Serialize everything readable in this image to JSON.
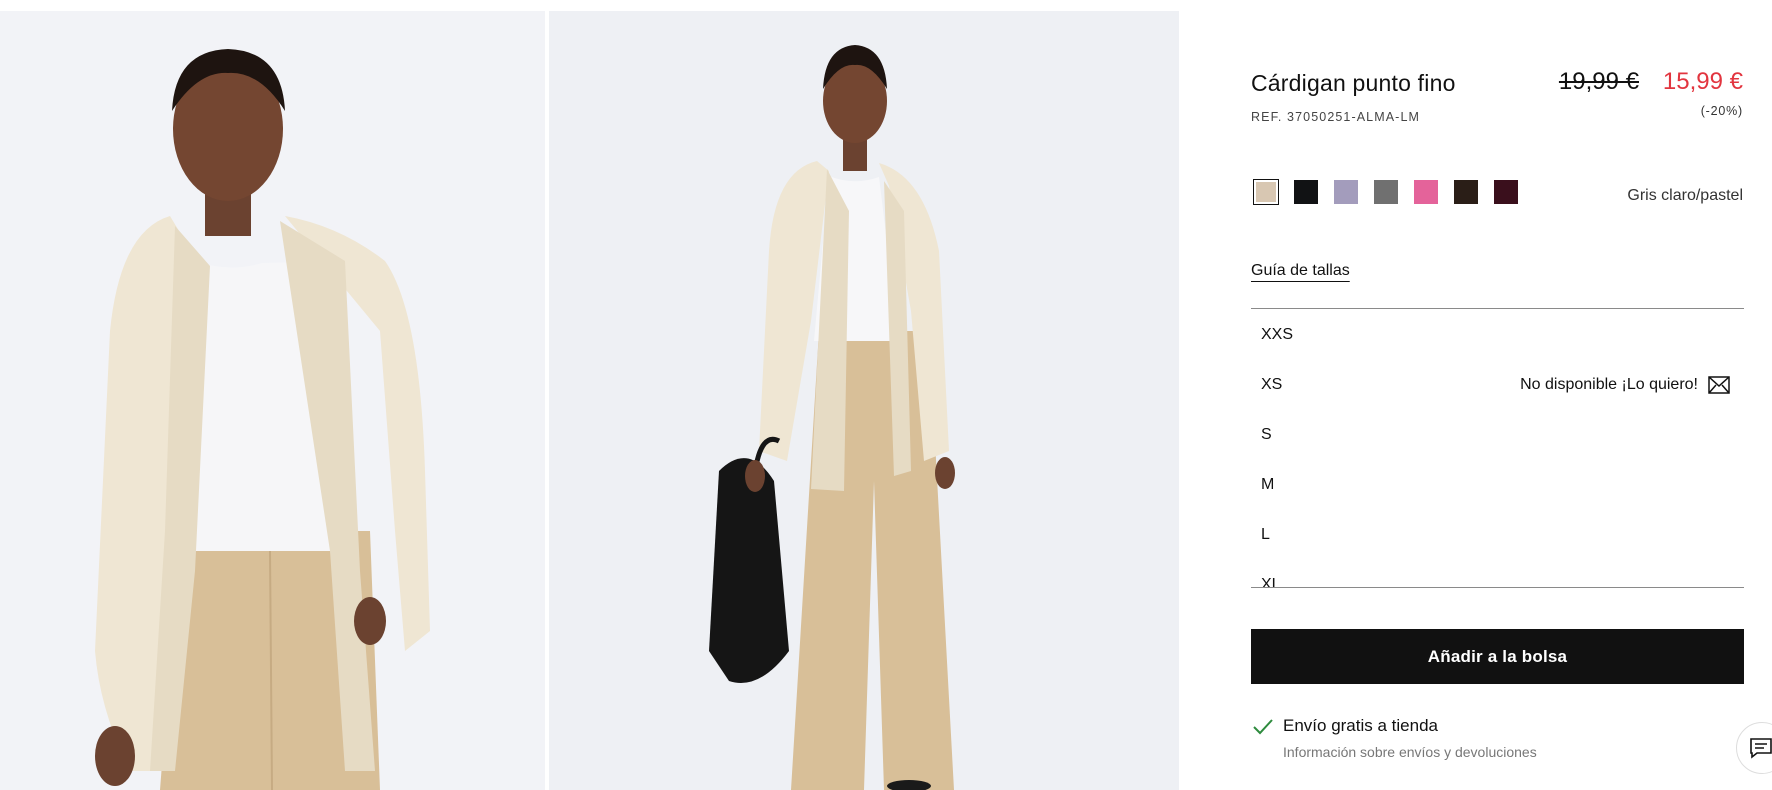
{
  "product": {
    "title": "Cárdigan punto fino",
    "ref": "REF. 37050251-ALMA-LM",
    "price_old": "19,99 €",
    "price_new": "15,99 €",
    "discount": "(-20%)"
  },
  "colors": {
    "selected_name": "Gris claro/pastel",
    "swatches": [
      {
        "hex": "#d8c7b2",
        "selected": true
      },
      {
        "hex": "#111214",
        "selected": false
      },
      {
        "hex": "#a39cbc",
        "selected": false
      },
      {
        "hex": "#707070",
        "selected": false
      },
      {
        "hex": "#e4639a",
        "selected": false
      },
      {
        "hex": "#2a1e17",
        "selected": false
      },
      {
        "hex": "#3a0f1c",
        "selected": false
      }
    ]
  },
  "size_guide_label": "Guía de tallas",
  "sizes": [
    {
      "label": "XXS",
      "status": ""
    },
    {
      "label": "XS",
      "status": "No disponible ¡Lo quiero!"
    },
    {
      "label": "S",
      "status": ""
    },
    {
      "label": "M",
      "status": ""
    },
    {
      "label": "L",
      "status": ""
    },
    {
      "label": "XL",
      "status": ""
    }
  ],
  "add_to_bag_label": "Añadir a la bolsa",
  "shipping": {
    "title": "Envío gratis a tienda",
    "link": "Información sobre envíos y devoluciones"
  },
  "accent": {
    "sale_red": "#e2353f",
    "button_black": "#111111",
    "check_green": "#2e8b3e"
  }
}
